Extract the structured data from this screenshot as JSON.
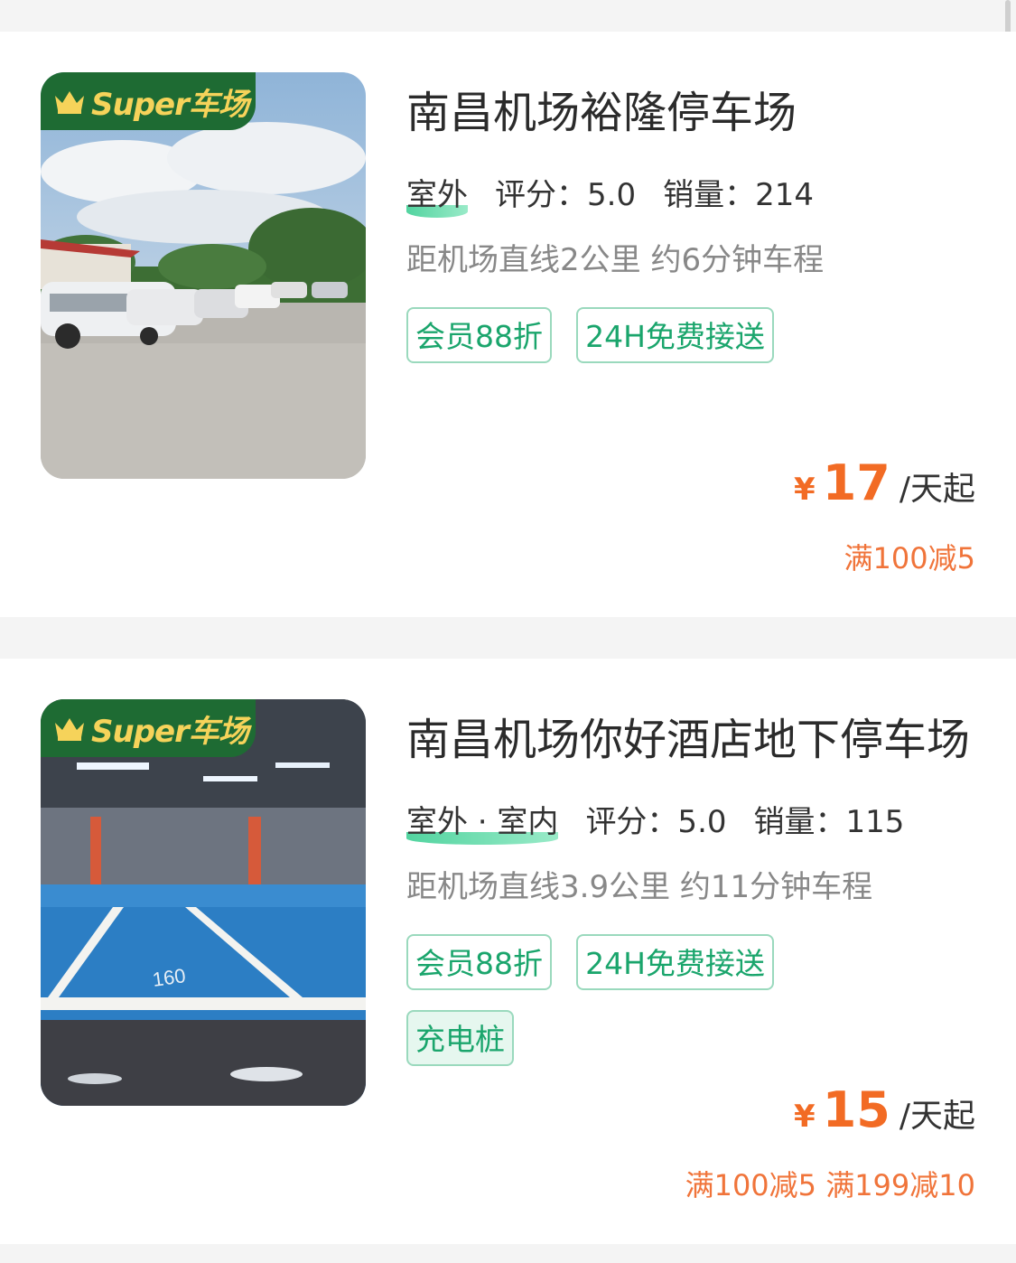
{
  "badge": {
    "text": "Super车场"
  },
  "colors": {
    "accent_green": "#1aa56c",
    "price_orange": "#f26b24",
    "badge_green": "#1e6b33"
  },
  "lots": [
    {
      "name": "南昌机场裕隆停车场",
      "location": "室外",
      "rating_label": "评分：5.0",
      "sales_label": "销量：214",
      "distance": "距机场直线2公里 约6分钟车程",
      "tags": [
        "会员88折",
        "24H免费接送"
      ],
      "currency": "¥",
      "price": "17",
      "unit": "/天起",
      "promo": "满100减5"
    },
    {
      "name": "南昌机场你好酒店地下停车场",
      "location": "室外 · 室内",
      "rating_label": "评分：5.0",
      "sales_label": "销量：115",
      "distance": "距机场直线3.9公里 约11分钟车程",
      "tags": [
        "会员88折",
        "24H免费接送",
        "充电桩"
      ],
      "currency": "¥",
      "price": "15",
      "unit": "/天起",
      "promo": "满100减5 满199减10"
    }
  ]
}
